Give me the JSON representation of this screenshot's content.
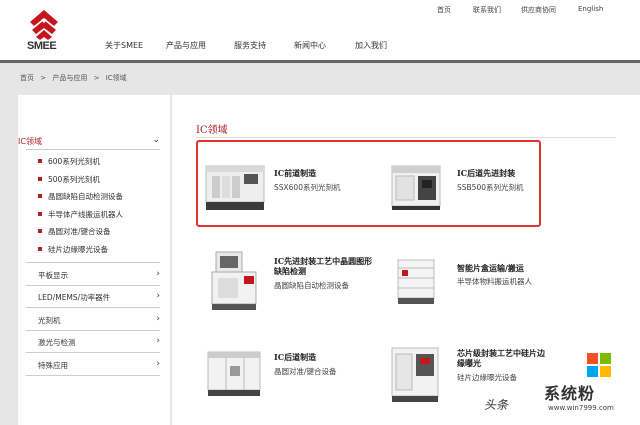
{
  "header": {
    "logo_text": "SMEE",
    "top_links": [
      "首页",
      "联系我们",
      "供应商协同",
      "English"
    ],
    "nav": [
      "关于SMEE",
      "产品与应用",
      "服务支持",
      "新闻中心",
      "加入我们"
    ]
  },
  "breadcrumb": [
    "首页",
    ">",
    "产品与应用",
    ">",
    "IC领域"
  ],
  "sidebar": {
    "active_category": "IC领域",
    "sub_items": [
      "600系列光刻机",
      "500系列光刻机",
      "晶圆缺陷自动检测设备",
      "半导体产线搬运机器人",
      "晶圆对准/键合设备",
      "硅片边缘曝光设备"
    ],
    "categories": [
      "平板显示",
      "LED/MEMS/功率器件",
      "光刻机",
      "激光与检测",
      "特殊应用"
    ]
  },
  "content": {
    "section_title": "IC领域",
    "products": [
      {
        "title": "IC前道制造",
        "subtitle": "SSX600系列光刻机"
      },
      {
        "title": "IC后道先进封装",
        "subtitle": "SSB500系列光刻机"
      },
      {
        "title": "IC先进封装工艺中晶圆图形缺陷检测",
        "subtitle": "晶圆缺陷自动检测设备"
      },
      {
        "title": "智能片盒运输/搬运",
        "subtitle": "半导体物料搬运机器人"
      },
      {
        "title": "IC后道制造",
        "subtitle": "晶圆对准/键合设备"
      },
      {
        "title": "芯片级封装工艺中硅片边缘曝光",
        "subtitle": "硅片边缘曝光设备"
      }
    ]
  },
  "watermark": {
    "brand": "系统粉",
    "url": "www.win7999.com",
    "signature": "头条"
  },
  "colors": {
    "accent": "#b01e23",
    "highlight": "#e0322f",
    "background": "#e6e6e6"
  }
}
